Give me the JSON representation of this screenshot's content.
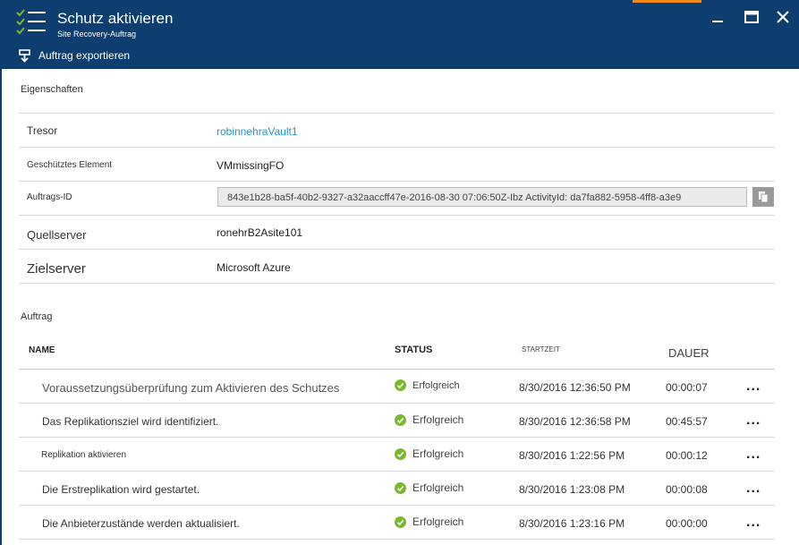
{
  "header": {
    "title": "Schutz aktivieren",
    "subtitle": "Site Recovery-Auftrag",
    "export_label": "Auftrag exportieren"
  },
  "properties": {
    "section_label": "Eigenschaften",
    "rows": [
      {
        "key": "Tresor",
        "value": "robinnehraVault1"
      },
      {
        "key": "Geschütztes Element",
        "value": "VMmissingFO"
      },
      {
        "key": "Auftrags-ID",
        "value": "843e1b28-ba5f-40b2-9327-a32aaccff47e-2016-08-30 07:06:50Z-Ibz ActivityId: da7fa882-5958-4ff8-a3e9"
      },
      {
        "key": "Quellserver",
        "value": "ronehrB2Asite101"
      },
      {
        "key": "Zielserver",
        "value": "Microsoft Azure"
      }
    ]
  },
  "jobs": {
    "section_label": "Auftrag",
    "columns": {
      "name": "NAME",
      "status": "STATUS",
      "start": "STARTZEIT",
      "duration": "DAUER"
    },
    "rows": [
      {
        "name": "Voraussetzungsüberprüfung zum Aktivieren des Schutzes",
        "status": "Erfolgreich",
        "start": "8/30/2016 12:36:50 PM",
        "duration": "00:00:07",
        "more": "..."
      },
      {
        "name": "Das Replikationsziel wird identifiziert.",
        "status": "Erfolgreich",
        "start": "8/30/2016 12:36:58 PM",
        "duration": "00:45:57",
        "more": "..."
      },
      {
        "name": "Replikation aktivieren",
        "status": "Erfolgreich",
        "start": "8/30/2016 1:22:56 PM",
        "duration": "00:00:12",
        "more": "..."
      },
      {
        "name": "Die Erstreplikation wird gestartet.",
        "status": "Erfolgreich",
        "start": "8/30/2016 1:23:08 PM",
        "duration": "00:00:08",
        "more": "..."
      },
      {
        "name": "Die Anbieterzustände werden aktualisiert.",
        "status": "Erfolgreich",
        "start": "8/30/2016 1:23:16 PM",
        "duration": "00:00:00",
        "more": "..."
      }
    ]
  },
  "colors": {
    "header_bg": "#0d3e6f",
    "link": "#1b93d4",
    "success": "#7cb82f",
    "accent": "#f28c1c"
  },
  "icons": {
    "logo": "checklist-icon",
    "export": "download-icon",
    "copy": "copy-icon",
    "status": "check-circle-icon"
  }
}
